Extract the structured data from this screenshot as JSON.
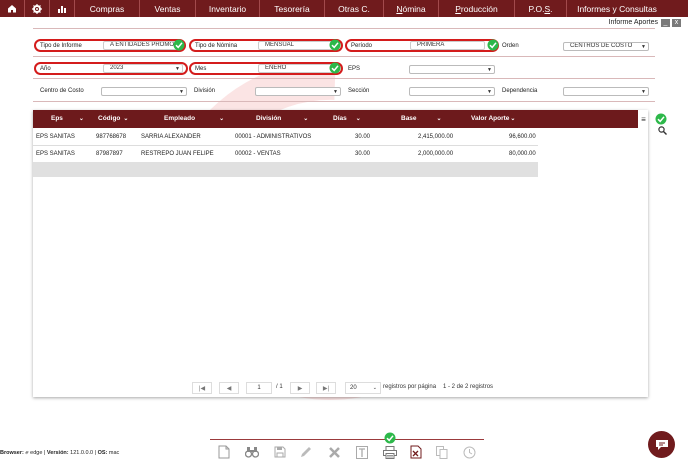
{
  "nav": {
    "items": [
      {
        "label": "Compras"
      },
      {
        "label": "Ventas"
      },
      {
        "label": "Inventario"
      },
      {
        "label": "Tesorería"
      },
      {
        "label": "Otras C."
      },
      {
        "label": "Nómina",
        "u": "N"
      },
      {
        "label": "Producción",
        "u": "P"
      },
      {
        "label": "P.O.S.",
        "u": "S"
      },
      {
        "label": "Informes y Consultas"
      }
    ]
  },
  "window": {
    "title": "Informe Aportes",
    "minimize": "_",
    "close": "x"
  },
  "filters": {
    "tipo_informe": {
      "label": "Tipo de Informe",
      "value": "A ENTIDADES PROMO"
    },
    "tipo_nomina": {
      "label": "Tipo de Nómina",
      "value": "MENSUAL"
    },
    "periodo": {
      "label": "Período",
      "value": "PRIMERA"
    },
    "orden": {
      "label": "Orden",
      "value": "CENTROS DE COSTO"
    },
    "anio": {
      "label": "Año",
      "value": "2023"
    },
    "mes": {
      "label": "Mes",
      "value": "ENERO"
    },
    "eps": {
      "label": "EPS",
      "value": ""
    },
    "centro_costo": {
      "label": "Centro de Costo",
      "value": ""
    },
    "division": {
      "label": "División",
      "value": ""
    },
    "seccion": {
      "label": "Sección",
      "value": ""
    },
    "dependencia": {
      "label": "Dependencia",
      "value": ""
    }
  },
  "table": {
    "columns": [
      "Eps",
      "Código",
      "Empleado",
      "División",
      "Días",
      "Base",
      "Valor Aporte"
    ],
    "rows": [
      {
        "eps": "EPS SANITAS",
        "codigo": "987768678",
        "empleado": "SARRIA  ALEXANDER",
        "division": "00001 - ADMINISTRATIVOS",
        "dias": "30.00",
        "base": "2,415,000.00",
        "valor": "96,600.00"
      },
      {
        "eps": "EPS SANITAS",
        "codigo": "87987897",
        "empleado": "RESTREPO  JUAN FELIPE",
        "division": "00002 - VENTAS",
        "dias": "30.00",
        "base": "2,000,000.00",
        "valor": "80,000.00"
      }
    ]
  },
  "pager": {
    "first": "|◀",
    "prev": "◀",
    "page": "1",
    "of": "/ 1",
    "next": "▶",
    "last": "▶|",
    "page_size": "20",
    "page_size_label": "registros por página",
    "range": "1 - 2 de 2 registros"
  },
  "footer": {
    "browser_label": "Browser:",
    "browser": "edge",
    "version_label": "Versión:",
    "version": "121.0.0.0",
    "os_label": "OS:",
    "os": "mac"
  },
  "colors": {
    "brand": "#701b1d",
    "check": "#2db84a",
    "highlight": "#d41c1c"
  }
}
